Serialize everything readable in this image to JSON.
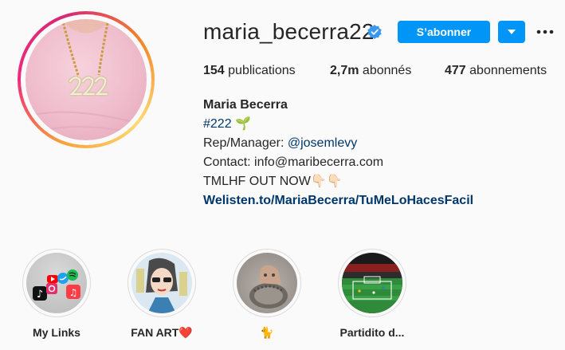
{
  "profile": {
    "username": "maria_becerra22",
    "verified": true,
    "follow_label": "S’abonner",
    "stats": {
      "posts_count": "154",
      "posts_label": "publications",
      "followers_count": "2,7m",
      "followers_label": "abonnés",
      "following_count": "477",
      "following_label": "abonnements"
    },
    "bio": {
      "name": "Maria Becerra",
      "hashtag": "#222",
      "hashtag_emoji": "🌱",
      "manager_prefix": "Rep/Manager: ",
      "manager_handle": "@josemlevy",
      "contact": "Contact: info@maribecerra.com",
      "announcement": "TMLHF OUT NOW",
      "announcement_emoji": "👇🏻👇🏻",
      "website": "Welisten.to/MariaBecerra/TuMeLoHacesFacil"
    }
  },
  "highlights": [
    {
      "label": "My Links"
    },
    {
      "label": "FAN ART❤️"
    },
    {
      "label": "🐈"
    },
    {
      "label": "Partidito d..."
    }
  ],
  "colors": {
    "accent": "#0095f6",
    "link": "#00376b",
    "text": "#262626",
    "background": "#fafafa",
    "verified_badge": "#3897f0"
  },
  "icons": {
    "verified": "verified-badge-icon",
    "dropdown": "chevron-down-icon",
    "more": "more-options-icon"
  }
}
